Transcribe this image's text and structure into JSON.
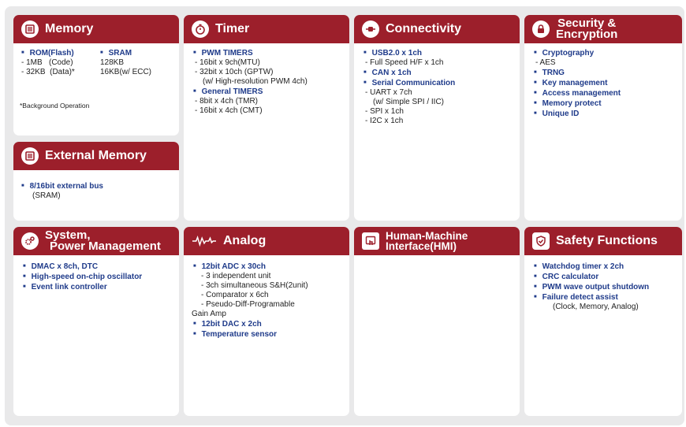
{
  "memory": {
    "title": "Memory",
    "rom_label": "ROM(Flash)",
    "rom_lines": [
      "- 1MB   (Code)",
      "- 32KB  (Data)*"
    ],
    "sram_label": "SRAM",
    "sram_lines": [
      "128KB",
      "16KB(w/ ECC)"
    ],
    "note": "*Background Operation"
  },
  "external_memory": {
    "title": "External Memory",
    "item": "8/16bit external bus",
    "item_sub": "(SRAM)"
  },
  "timer": {
    "title": "Timer",
    "pwm_label": "PWM TIMERS",
    "pwm_lines": [
      "- 16bit x 9ch(MTU)",
      "- 32bit x 10ch (GPTW)",
      "(w/ High-resolution PWM 4ch)"
    ],
    "general_label": "General TIMERS",
    "general_lines": [
      "- 8bit x 4ch (TMR)",
      "- 16bit x 4ch (CMT)"
    ]
  },
  "connectivity": {
    "title": "Connectivity",
    "usb_label": "USB2.0 x 1ch",
    "usb_line": "- Full Speed H/F x 1ch",
    "can_label": "CAN x 1ch",
    "serial_label": "Serial Communication",
    "serial_lines": [
      "- UART x 7ch",
      "(w/ Simple SPI / IIC)",
      "- SPI x 1ch",
      "- I2C x 1ch"
    ]
  },
  "security": {
    "title_line1": "Security &",
    "title_line2": "Encryption",
    "crypto_label": "Cryptography",
    "crypto_line": "- AES",
    "items": [
      "TRNG",
      "Key management",
      "Access management",
      "Memory protect",
      "Unique ID"
    ]
  },
  "system": {
    "title_line1": "System,",
    "title_line2": "Power Management",
    "items": [
      "DMAC x 8ch, DTC",
      "High-speed on-chip oscillator",
      "Event link controller"
    ]
  },
  "analog": {
    "title": "Analog",
    "adc_label": "12bit  ADC x 30ch",
    "adc_lines": [
      "- 3 independent unit",
      "- 3ch simultaneous S&H(2unit)",
      "- Comparator x 6ch",
      "- Pseudo-Diff-Programable"
    ],
    "adc_wrap": "Gain Amp",
    "dac_label": "12bit DAC x 2ch",
    "temp_label": "Temperature sensor"
  },
  "hmi": {
    "title_line1": "Human-Machine",
    "title_line2": "Interface(HMI)"
  },
  "safety": {
    "title": "Safety Functions",
    "items": [
      "Watchdog timer x 2ch",
      "CRC calculator",
      "PWM wave output shutdown",
      "Failure detect assist"
    ],
    "note": "(Clock, Memory, Analog)"
  },
  "colors": {
    "header": "#9c1f2b",
    "label_blue": "#1f3b8a",
    "panel_bg": "#e9e9ea"
  }
}
